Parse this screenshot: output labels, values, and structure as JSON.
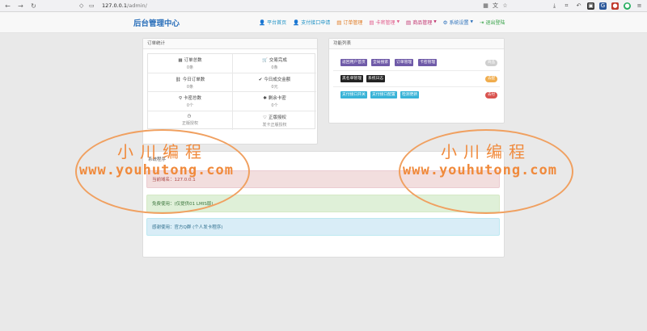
{
  "browser": {
    "url_host": "127.0.0.1",
    "url_path": "/admin/"
  },
  "navbar": {
    "brand": "后台管理中心",
    "links": [
      {
        "label": "平台首页",
        "color": "#1a8fc4"
      },
      {
        "label": "支付接口申请",
        "color": "#1a8fc4"
      },
      {
        "label": "订单管理",
        "color": "#e07b24"
      },
      {
        "label": "卡密管理",
        "color": "#e05a8a"
      },
      {
        "label": "商品管理",
        "color": "#c0336e"
      },
      {
        "label": "系统设置",
        "color": "#2a6fba"
      },
      {
        "label": "退出登陆",
        "color": "#3aa34a"
      }
    ]
  },
  "order_panel": {
    "title": "订单统计",
    "stats": [
      {
        "label": "订单总数",
        "value": "0条"
      },
      {
        "label": "交易完成",
        "value": "0条"
      },
      {
        "label": "今日订单数",
        "value": "0条"
      },
      {
        "label": "今日成交金额",
        "value": "0元"
      },
      {
        "label": "卡密总数",
        "value": "0个"
      },
      {
        "label": "剩余卡密",
        "value": "0个"
      },
      {
        "label": "",
        "value": "正版授权"
      },
      {
        "label": "正版授权",
        "value": "发卡正版授权"
      }
    ]
  },
  "func_panel": {
    "title": "功能列表",
    "rows": [
      {
        "buttons": [
          "返回用户首页",
          "全局搜索",
          "订单管理",
          "卡密管理"
        ],
        "badge": "商品",
        "badge_color": "#cfcfcf"
      },
      {
        "buttons": [
          "黑名单管理",
          "系统日志"
        ],
        "badge": "去配",
        "badge_color": "#f0ad4e"
      },
      {
        "buttons": [
          "支付接口开关",
          "支付接口配置",
          "检测更新"
        ],
        "badge": "去付",
        "badge_color": "#d9534f"
      }
    ]
  },
  "system": {
    "title": "系统程序",
    "alerts": [
      "当前域名：127.0.0.1",
      "免费使用：(仅提供01 LMIS版)",
      "感谢使用：官方Q群 (个人发卡程序)"
    ]
  },
  "watermark": {
    "title": "小川编程",
    "url": "www.youhutong.com"
  }
}
